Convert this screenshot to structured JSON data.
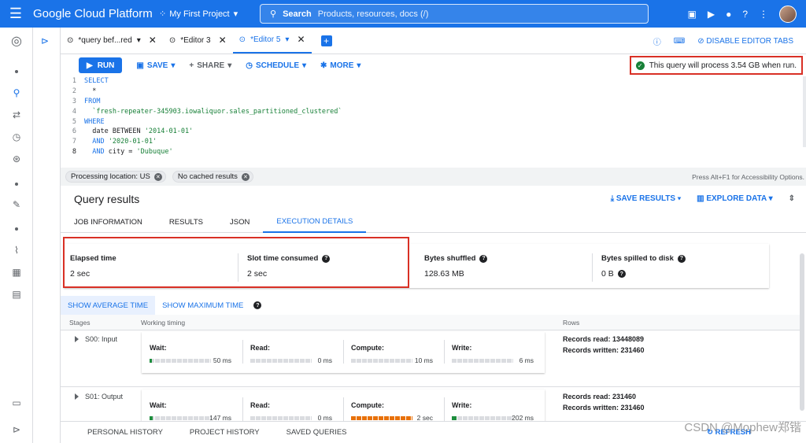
{
  "topbar": {
    "brand": "Google Cloud Platform",
    "project": "My First Project",
    "search_label": "Search",
    "search_placeholder": "Products, resources, docs (/)"
  },
  "tabs": [
    {
      "label": "*query bef...red"
    },
    {
      "label": "*Editor 3"
    },
    {
      "label": "*Editor 5"
    }
  ],
  "tabbar_right": {
    "disable_label": "DISABLE EDITOR TABS"
  },
  "toolbar": {
    "run": "RUN",
    "save": "SAVE",
    "share": "SHARE",
    "schedule": "SCHEDULE",
    "more": "MORE",
    "query_note": "This query will process 3.54 GB when run."
  },
  "editor": {
    "lines": [
      {
        "n": "1",
        "parts": [
          {
            "t": "SELECT",
            "c": "kw"
          }
        ]
      },
      {
        "n": "2",
        "parts": [
          {
            "t": "  *",
            "c": "plain"
          }
        ]
      },
      {
        "n": "3",
        "parts": [
          {
            "t": "FROM",
            "c": "kw"
          }
        ]
      },
      {
        "n": "4",
        "parts": [
          {
            "t": "  `fresh-repeater-345903.iowaliquor.sales_partitioned_clustered`",
            "c": "str"
          }
        ]
      },
      {
        "n": "5",
        "parts": [
          {
            "t": "WHERE",
            "c": "kw"
          }
        ]
      },
      {
        "n": "6",
        "parts": [
          {
            "t": "  date BETWEEN ",
            "c": "plain"
          },
          {
            "t": "'2014-01-01'",
            "c": "str"
          }
        ]
      },
      {
        "n": "7",
        "parts": [
          {
            "t": "  AND ",
            "c": "kw"
          },
          {
            "t": "'2020-01-01'",
            "c": "str"
          }
        ]
      },
      {
        "n": "8",
        "parts": [
          {
            "t": "  AND ",
            "c": "kw"
          },
          {
            "t": "city = ",
            "c": "plain"
          },
          {
            "t": "'Dubuque'",
            "c": "str"
          }
        ]
      }
    ]
  },
  "chips": {
    "location": "Processing location: US",
    "cache": "No cached results",
    "accessibility": "Press Alt+F1 for Accessibility Options."
  },
  "results": {
    "title": "Query results",
    "save_results": "SAVE RESULTS",
    "explore_data": "EXPLORE DATA",
    "tabs": [
      "JOB INFORMATION",
      "RESULTS",
      "JSON",
      "EXECUTION DETAILS"
    ]
  },
  "stats": {
    "elapsed_label": "Elapsed time",
    "elapsed_value": "2 sec",
    "slot_label": "Slot time consumed",
    "slot_value": "2 sec",
    "shuffled_label": "Bytes shuffled",
    "shuffled_value": "128.63 MB",
    "spilled_label": "Bytes spilled to disk",
    "spilled_value": "0 B"
  },
  "timetoggle": {
    "avg": "SHOW AVERAGE TIME",
    "max": "SHOW MAXIMUM TIME"
  },
  "stage_head": {
    "stages": "Stages",
    "timing": "Working timing",
    "rows": "Rows"
  },
  "stages": [
    {
      "name": "S00: Input",
      "wait_label": "Wait:",
      "wait_value": "50 ms",
      "wait_fill": 0.02,
      "read_label": "Read:",
      "read_value": "0 ms",
      "read_fill": 0,
      "compute_label": "Compute:",
      "compute_value": "10 ms",
      "compute_fill": 0,
      "write_label": "Write:",
      "write_value": "6 ms",
      "write_fill": 0,
      "records_read": "Records read: 13448089",
      "records_written": "Records written: 231460"
    },
    {
      "name": "S01: Output",
      "wait_label": "Wait:",
      "wait_value": "147 ms",
      "wait_fill": 0.05,
      "read_label": "Read:",
      "read_value": "0 ms",
      "read_fill": 0,
      "compute_label": "Compute:",
      "compute_value": "2 sec",
      "compute_fill": 1,
      "write_label": "Write:",
      "write_value": "202 ms",
      "write_fill": 0.08,
      "records_read": "Records read: 231460",
      "records_written": "Records written: 231460"
    }
  ],
  "bottom": {
    "personal": "PERSONAL HISTORY",
    "project": "PROJECT HISTORY",
    "saved": "SAVED QUERIES",
    "refresh": "REFRESH",
    "watermark": "CSDN @Mophew郑锴"
  }
}
